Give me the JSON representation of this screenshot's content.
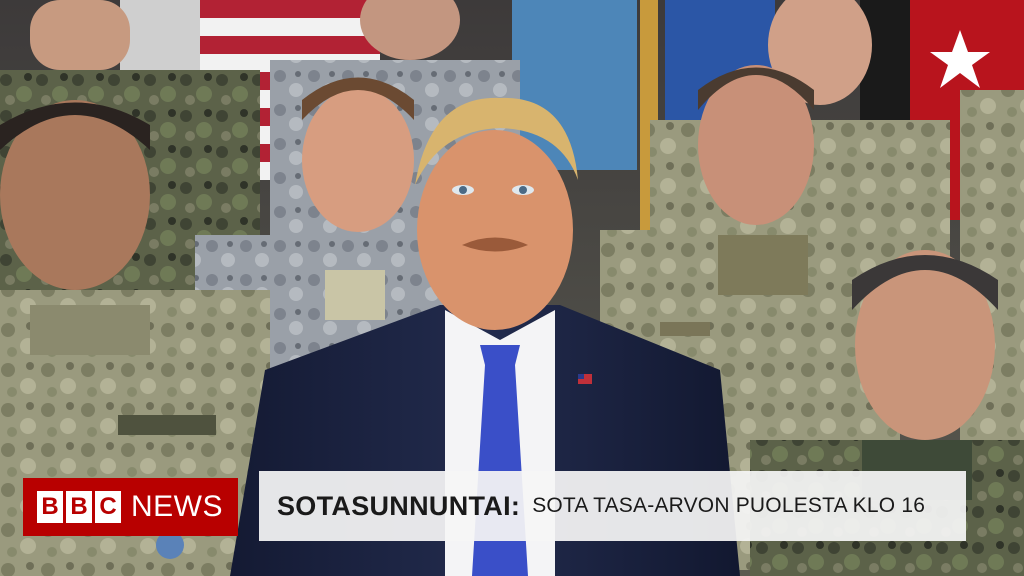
{
  "logo": {
    "blocks": [
      "B",
      "B",
      "C"
    ],
    "news": "NEWS"
  },
  "strap": {
    "title": "SOTASUNNUNTAI:",
    "text": "SOTA TASA-ARVON PUOLESTA KLO 16"
  },
  "colors": {
    "bbc_red": "#b80000",
    "strap_bg": "#f5f5f5",
    "strap_text": "#1a1a1a"
  }
}
